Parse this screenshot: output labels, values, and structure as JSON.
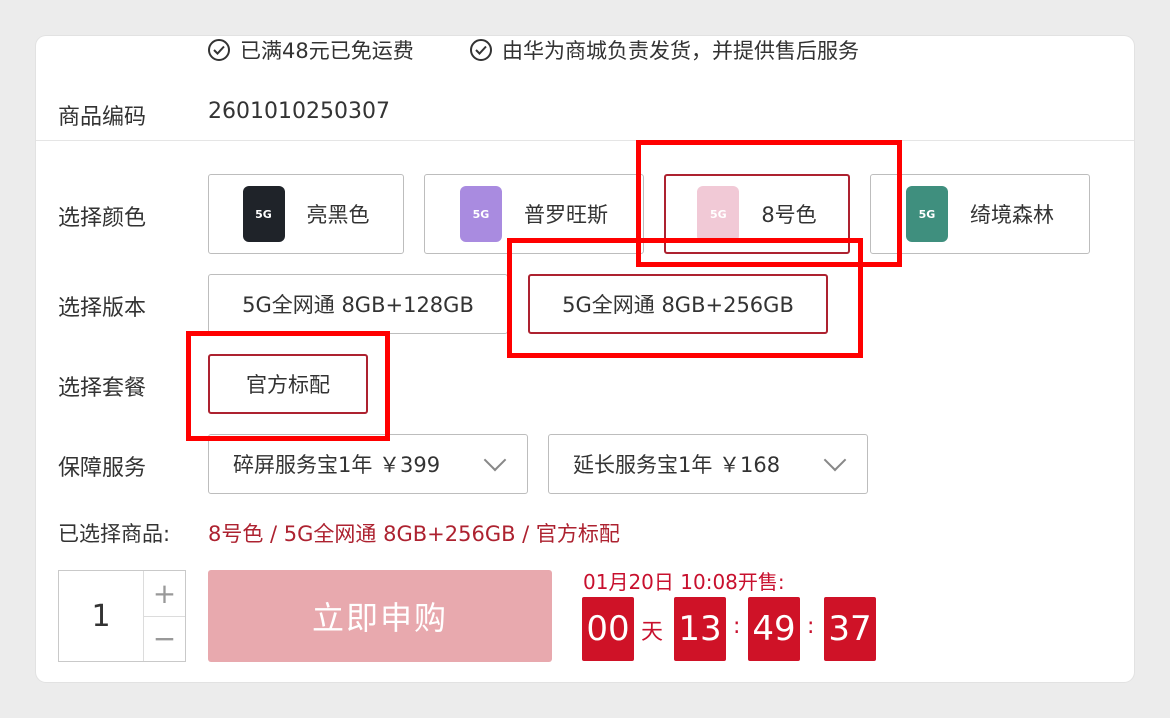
{
  "shipping": {
    "free_shipping": "已满48元已免运费",
    "service": "由华为商城负责发货，并提供售后服务"
  },
  "product_code": {
    "label": "商品编码",
    "value": "2601010250307"
  },
  "color": {
    "label": "选择颜色",
    "options": [
      {
        "name": "亮黑色",
        "swatch": "#1f2329"
      },
      {
        "name": "普罗旺斯",
        "swatch": "#a98be0"
      },
      {
        "name": "8号色",
        "swatch": "#f1c9d6",
        "selected": true
      },
      {
        "name": "绮境森林",
        "swatch": "#3f8f7e"
      }
    ],
    "phone_badge": "5G"
  },
  "version": {
    "label": "选择版本",
    "options": [
      {
        "name": "5G全网通 8GB+128GB"
      },
      {
        "name": "5G全网通 8GB+256GB",
        "selected": true
      }
    ]
  },
  "package": {
    "label": "选择套餐",
    "options": [
      {
        "name": "官方标配",
        "selected": true
      }
    ]
  },
  "services": {
    "label": "保障服务",
    "options": [
      {
        "name": "碎屏服务宝1年 ￥399"
      },
      {
        "name": "延长服务宝1年 ￥168"
      }
    ]
  },
  "selected": {
    "label": "已选择商品:",
    "value": "8号色 / 5G全网通 8GB+256GB / 官方标配"
  },
  "quantity": {
    "value": "1",
    "plus": "+",
    "minus": "−"
  },
  "buy_button": "立即申购",
  "sale": {
    "time_label": "01月20日 10:08开售:",
    "days": "00",
    "day_unit": "天",
    "hours": "13",
    "minutes": "49",
    "seconds": "37",
    "sep": ":"
  },
  "colors": {
    "accent": "#ad2230",
    "countdown": "#cf1227",
    "highlight": "#ff0000",
    "button_disabled": "#e8a9ae"
  }
}
